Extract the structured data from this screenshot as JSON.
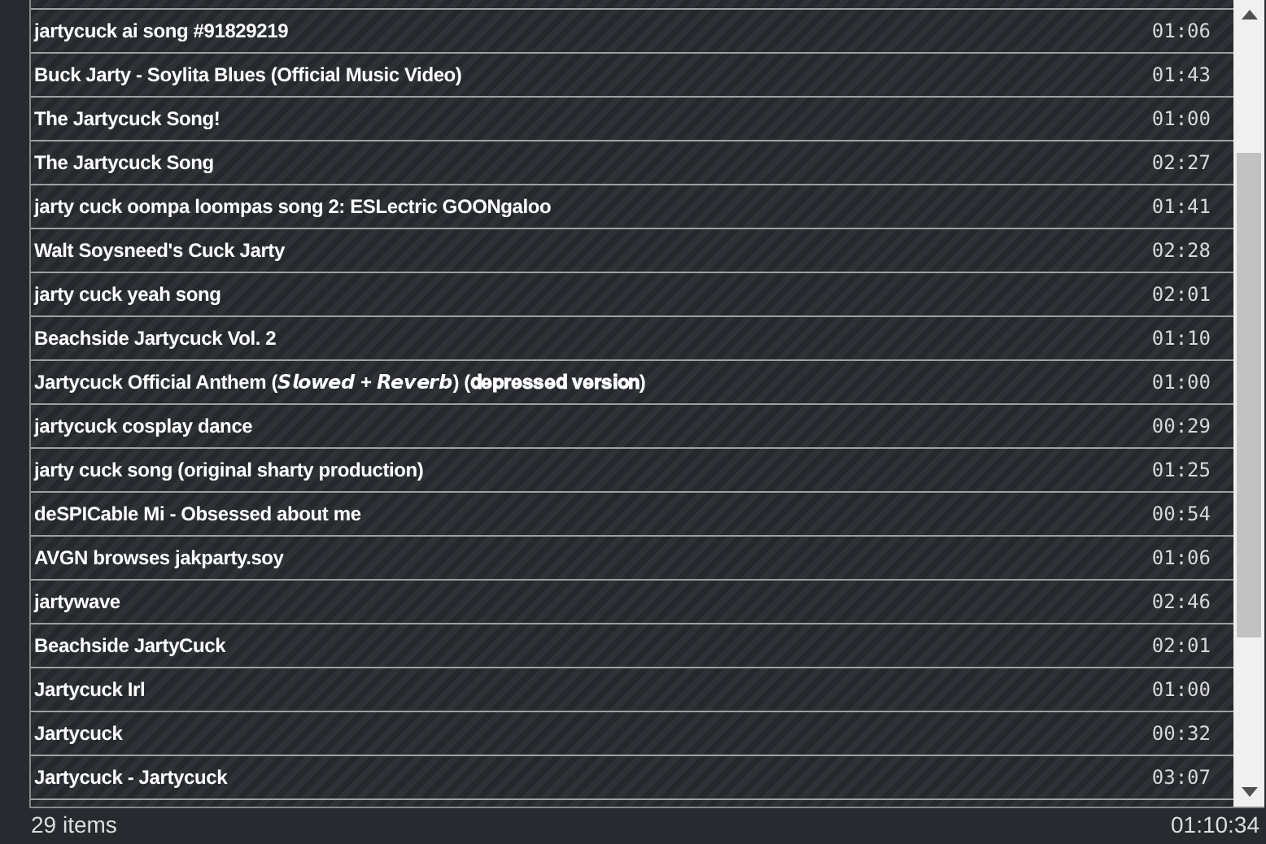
{
  "playlist": [
    {
      "title": "jartycuck ai song #91829219",
      "duration": "01:06"
    },
    {
      "title": "Buck Jarty - Soylita Blues (Official Music Video)",
      "duration": "01:43"
    },
    {
      "title": "The Jartycuck Song!",
      "duration": "01:00"
    },
    {
      "title": "The Jartycuck Song",
      "duration": "02:27"
    },
    {
      "title": "jarty cuck oompa loompas song 2: ESLectric GOONgaloo",
      "duration": "01:41"
    },
    {
      "title": "Walt Soysneed's Cuck Jarty",
      "duration": "02:28"
    },
    {
      "title": "jarty cuck yeah song",
      "duration": "02:01"
    },
    {
      "title": "Beachside Jartycuck Vol. 2",
      "duration": "01:10"
    },
    {
      "title": "Jartycuck Official Anthem (𝙎𝙡𝙤𝙬𝙚𝙙 + 𝙍𝙚𝙫𝙚𝙧𝙗) (𝐝𝐞𝐩𝐫𝐞𝐬𝐬𝐞𝐝 𝐯𝐞𝐫𝐬𝐢𝐨𝐧)",
      "duration": "01:00"
    },
    {
      "title": "jartycuck cosplay dance",
      "duration": "00:29"
    },
    {
      "title": "jarty cuck song (original sharty production)",
      "duration": "01:25"
    },
    {
      "title": "deSPICable Mi - Obsessed about me",
      "duration": "00:54"
    },
    {
      "title": "AVGN browses jakparty.soy",
      "duration": "01:06"
    },
    {
      "title": "jartywave",
      "duration": "02:46"
    },
    {
      "title": "Beachside JartyCuck",
      "duration": "02:01"
    },
    {
      "title": "Jartycuck Irl",
      "duration": "01:00"
    },
    {
      "title": "Jartycuck",
      "duration": "00:32"
    },
    {
      "title": "Jartycuck - Jartycuck",
      "duration": "03:07"
    }
  ],
  "footer": {
    "count": "29 items",
    "total": "01:10:34"
  }
}
